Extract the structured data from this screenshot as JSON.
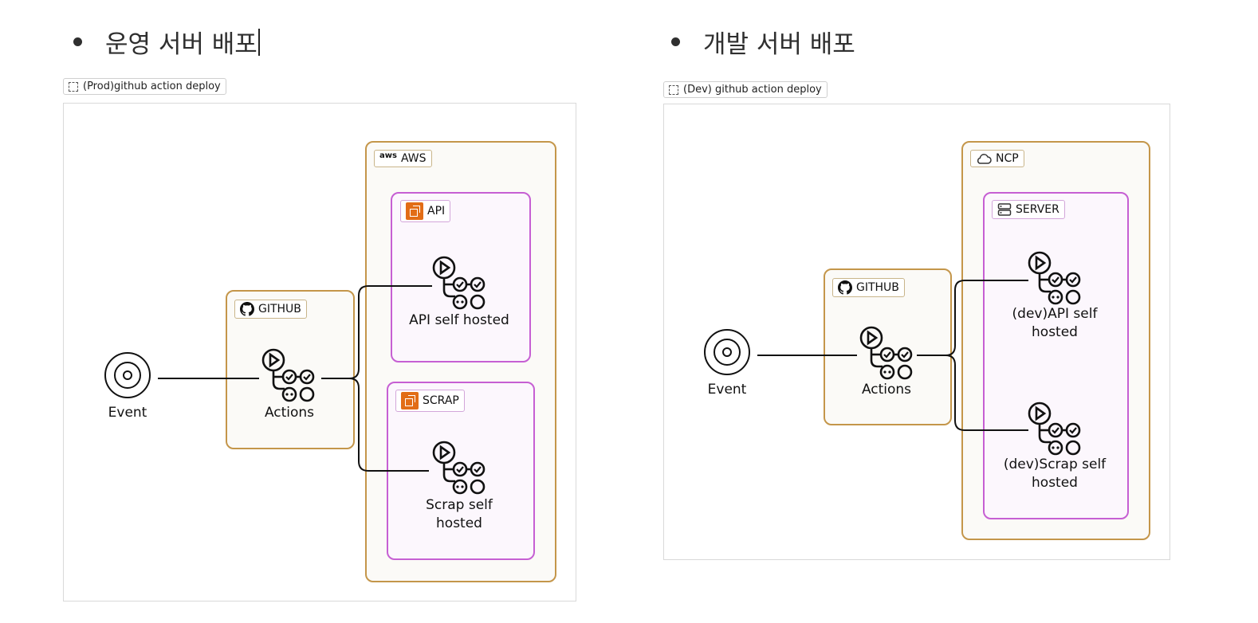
{
  "headings": {
    "prod": "운영 서버 배포",
    "dev": "개발 서버 배포"
  },
  "frames": {
    "prod": "(Prod)github action deploy",
    "dev": "(Dev) github action deploy"
  },
  "prod": {
    "cloud_label": "AWS",
    "cloud_logo_text": "aws",
    "github_label": "GITHUB",
    "api_group_label": "API",
    "scrap_group_label": "SCRAP",
    "event_label": "Event",
    "actions_label": "Actions",
    "api_node_label": "API self hosted",
    "scrap_node_label": "Scrap self hosted"
  },
  "dev": {
    "cloud_label": "NCP",
    "github_label": "GITHUB",
    "server_group_label": "SERVER",
    "event_label": "Event",
    "actions_label": "Actions",
    "api_node_label": "(dev)API self hosted",
    "scrap_node_label": "(dev)Scrap self hosted"
  },
  "colors": {
    "gold": "#c4964a",
    "purple": "#c65fd3",
    "aws_orange": "#e26d16"
  }
}
